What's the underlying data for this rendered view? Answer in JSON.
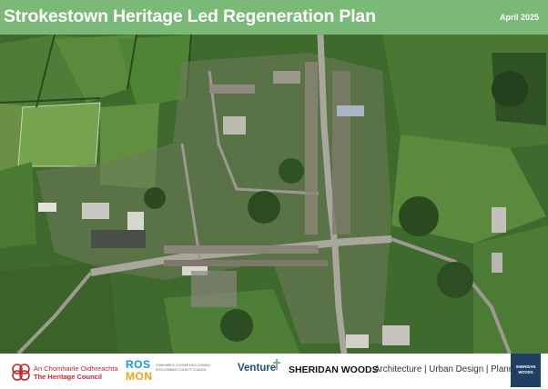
{
  "header": {
    "title": "Strokestown Heritage Led Regeneration Plan",
    "date": "April 2025"
  },
  "colors": {
    "header_green": "#7ab978",
    "heritage_red": "#c8262b",
    "rosmon_blue": "#1a9ad6",
    "rosmon_orange": "#f2a31b",
    "venture_blue": "#1b4f87",
    "sheridan_navy": "#1f3f63"
  },
  "footer": {
    "heritage_council": {
      "line1": "An Chomhairle Oidhreachta",
      "line2": "The Heritage Council",
      "icon": "heritage-council-logo-icon"
    },
    "rosmon": {
      "top": "ROS",
      "bottom": "MON",
      "small": "COMHAIRLE CONTAE ROS COMÁIN ROSCOMMON COUNTY COUNCIL"
    },
    "venture": {
      "name": "Venture",
      "icon": "venture-mark-icon"
    },
    "sheridan_woods": {
      "name": "SHERIDAN WOODS",
      "tagline": "Architecture | Urban Design | Planning",
      "box_line1": "SHERIDAN",
      "box_line2": "WOODS"
    }
  }
}
